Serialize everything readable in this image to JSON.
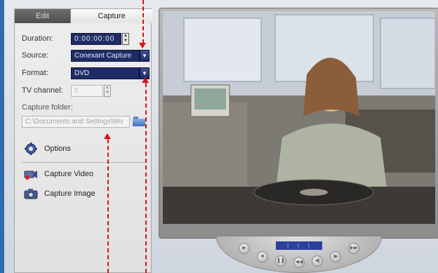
{
  "tabs": {
    "edit_label": "Edit",
    "capture_label": "Capture"
  },
  "capture": {
    "duration_label": "Duration:",
    "duration_value": "0:00:00:00",
    "source_label": "Source:",
    "source_value": "Conexant Capture",
    "format_label": "Format:",
    "format_value": "DVD",
    "tv_channel_label": "TV channel:",
    "tv_channel_value": "0",
    "folder_label": "Capture folder:",
    "folder_value": "C:\\Documents and Settings\\Wo"
  },
  "actions": {
    "options_label": "Options",
    "capture_video_label": "Capture Video",
    "capture_image_label": "Capture Image"
  },
  "player": {
    "timecode": ": : :"
  },
  "colors": {
    "annotation": "#d8101c",
    "field_bg": "#1f2c66",
    "frame_border": "#2f6ca9"
  },
  "icons": {
    "options": "gear-icon",
    "capture_video": "video-camera-icon",
    "capture_image": "photo-camera-icon",
    "folder": "folder-icon"
  }
}
